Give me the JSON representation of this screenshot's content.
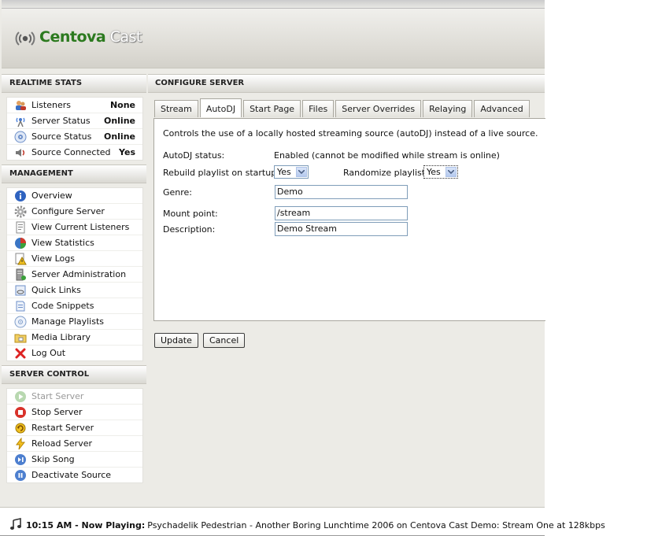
{
  "brand": {
    "name_part1": "Centova",
    "name_part2": "Cast"
  },
  "sidebar": {
    "realtime": {
      "title": "REALTIME STATS",
      "items": [
        {
          "label": "Listeners",
          "value": "None",
          "icon": "listeners-icon"
        },
        {
          "label": "Server Status",
          "value": "Online",
          "icon": "server-status-icon"
        },
        {
          "label": "Source Status",
          "value": "Online",
          "icon": "source-status-icon"
        },
        {
          "label": "Source Connected",
          "value": "Yes",
          "icon": "speaker-icon"
        }
      ]
    },
    "management": {
      "title": "MANAGEMENT",
      "items": [
        {
          "label": "Overview",
          "icon": "info-icon"
        },
        {
          "label": "Configure Server",
          "icon": "gear-icon"
        },
        {
          "label": "View Current Listeners",
          "icon": "document-icon"
        },
        {
          "label": "View Statistics",
          "icon": "pie-chart-icon"
        },
        {
          "label": "View Logs",
          "icon": "log-warning-icon"
        },
        {
          "label": "Server Administration",
          "icon": "server-admin-icon"
        },
        {
          "label": "Quick Links",
          "icon": "links-icon"
        },
        {
          "label": "Code Snippets",
          "icon": "code-icon"
        },
        {
          "label": "Manage Playlists",
          "icon": "playlist-icon"
        },
        {
          "label": "Media Library",
          "icon": "folder-icon"
        },
        {
          "label": "Log Out",
          "icon": "logout-icon"
        }
      ]
    },
    "control": {
      "title": "SERVER CONTROL",
      "items": [
        {
          "label": "Start Server",
          "icon": "play-icon",
          "disabled": true
        },
        {
          "label": "Stop Server",
          "icon": "stop-icon"
        },
        {
          "label": "Restart Server",
          "icon": "restart-icon"
        },
        {
          "label": "Reload Server",
          "icon": "lightning-icon"
        },
        {
          "label": "Skip Song",
          "icon": "skip-icon"
        },
        {
          "label": "Deactivate Source",
          "icon": "pause-icon"
        }
      ]
    }
  },
  "main": {
    "title": "CONFIGURE SERVER",
    "tabs": [
      "Stream",
      "AutoDJ",
      "Start Page",
      "Files",
      "Server Overrides",
      "Relaying",
      "Advanced"
    ],
    "active_tab": "AutoDJ",
    "description": "Controls the use of a locally hosted streaming source (autoDJ) instead of a live source.",
    "form": {
      "autodj_status_label": "AutoDJ status:",
      "autodj_status_value": "Enabled (cannot be modified while stream is online)",
      "rebuild_label": "Rebuild playlist on startup:",
      "rebuild_value": "Yes",
      "randomize_label": "Randomize playlist:",
      "randomize_value": "Yes",
      "genre_label": "Genre:",
      "genre_value": "Demo",
      "mount_label": "Mount point:",
      "mount_value": "/stream",
      "description_label": "Description:",
      "description_value": "Demo Stream"
    },
    "buttons": {
      "update": "Update",
      "cancel": "Cancel"
    }
  },
  "status_bar": {
    "time_now_playing": "10:15 AM - Now Playing:",
    "track": "Psychadelik Pedestrian - Another Boring Lunchtime 2006 on Centova Cast Demo: Stream One at 128kbps"
  }
}
